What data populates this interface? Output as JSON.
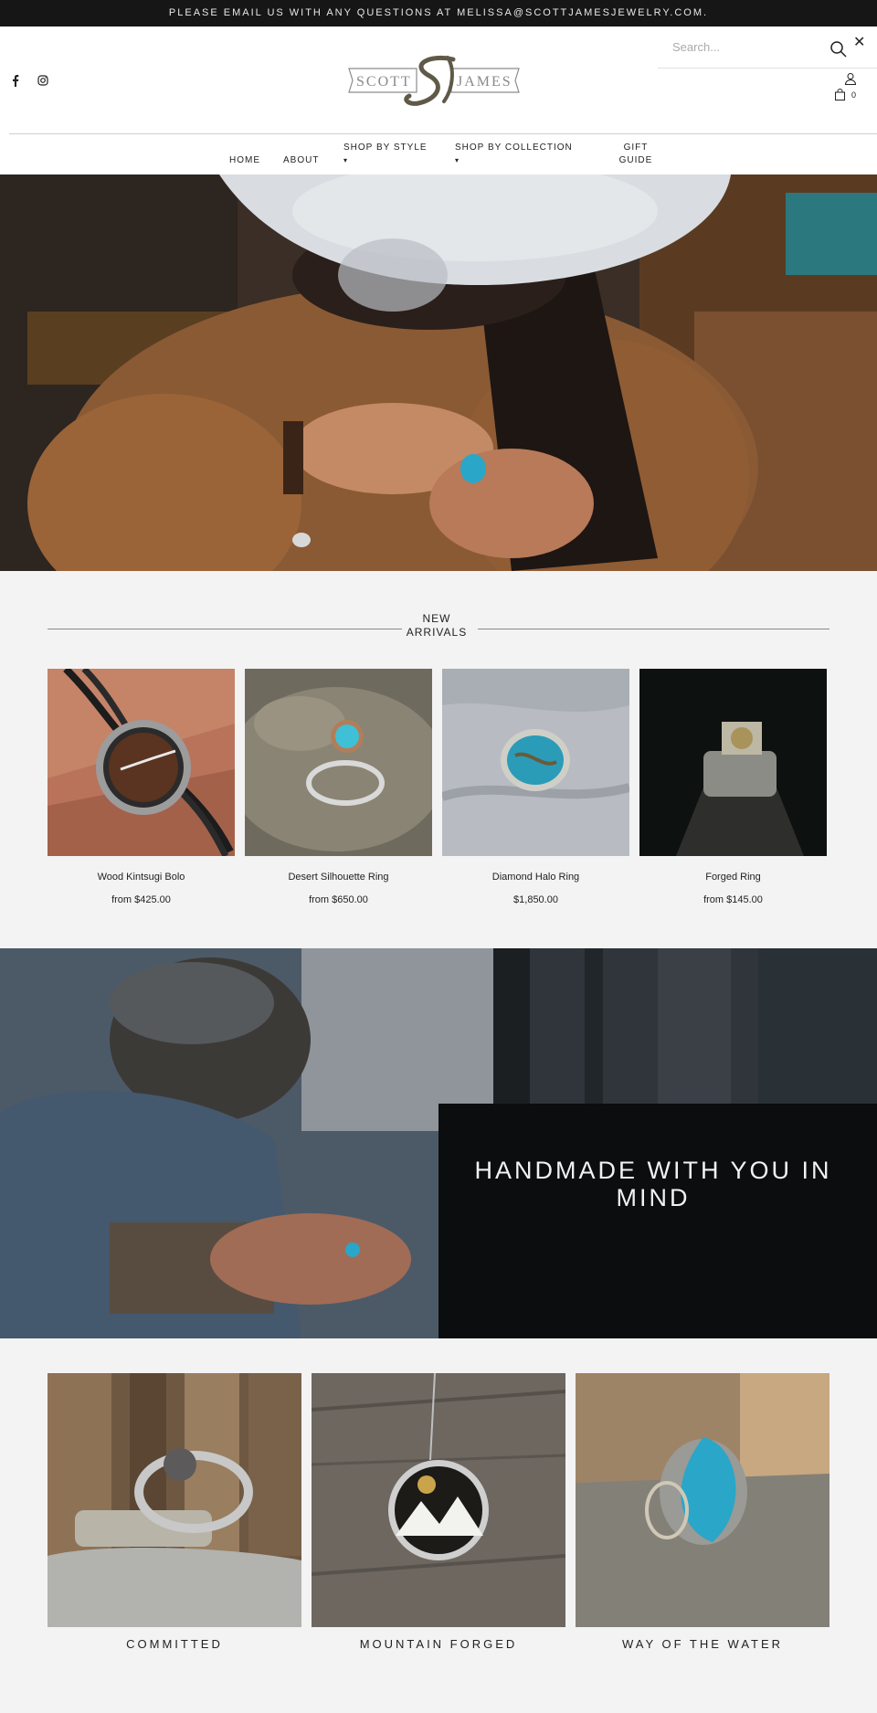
{
  "announcement": "PLEASE EMAIL US WITH ANY QUESTIONS AT MELISSA@SCOTTJAMESJEWELRY.COM.",
  "header": {
    "logo_left": "SCOTT",
    "logo_right": "JAMES",
    "search_placeholder": "Search...",
    "cart_count": "0",
    "icons": [
      "facebook-icon",
      "instagram-icon",
      "search-icon",
      "close-icon",
      "account-icon",
      "bag-icon"
    ]
  },
  "nav": {
    "items": [
      {
        "label": "HOME"
      },
      {
        "label": "ABOUT"
      },
      {
        "label": "SHOP BY STYLE",
        "caret": "▾"
      },
      {
        "label": "SHOP BY COLLECTION",
        "caret": "▾"
      },
      {
        "label": "GIFT GUIDE"
      }
    ]
  },
  "arrivals": {
    "title": "NEW ARRIVALS",
    "products": [
      {
        "name": "Wood Kintsugi Bolo",
        "price": "from $425.00"
      },
      {
        "name": "Desert Silhouette Ring",
        "price": "from $650.00"
      },
      {
        "name": "Diamond Halo Ring",
        "price": "$1,850.00"
      },
      {
        "name": "Forged Ring",
        "price": "from $145.00"
      }
    ]
  },
  "banner": {
    "headline": "HANDMADE WITH YOU IN MIND"
  },
  "collections": [
    {
      "label": "COMMITTED"
    },
    {
      "label": "MOUNTAIN FORGED"
    },
    {
      "label": "WAY OF THE WATER"
    }
  ],
  "colors": {
    "announcement_bg": "#161616",
    "section_bg": "#f3f3f3",
    "turquoise": "#2aa6c8"
  }
}
